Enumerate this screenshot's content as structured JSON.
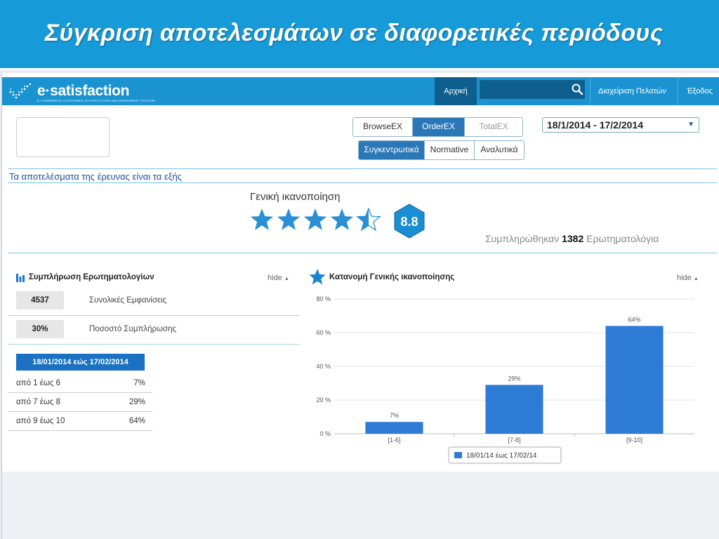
{
  "slide": {
    "title": "Σύγκριση αποτελεσμάτων σε διαφορετικές περιόδους"
  },
  "brand": {
    "name": "e·satisfaction",
    "tagline": "E-COMMERCE CUSTOMER SATISFACTION MEASUREMENT SYSTEM"
  },
  "nav": {
    "home": "Αρχική",
    "search_placeholder": "",
    "customers": "Διαχείριση Πελατών",
    "logout": "Έξοδος"
  },
  "survey_tabs": {
    "items": [
      "BrowseEX",
      "OrderEX",
      "TotalEX"
    ],
    "active": "OrderEX",
    "disabled": "TotalEX"
  },
  "view_tabs": {
    "items": [
      "Συγκεντρωτικά",
      "Normative",
      "Αναλυτικά"
    ],
    "active": "Συγκεντρωτικά"
  },
  "date_range": {
    "selected": "18/1/2014 - 17/2/2014",
    "caret": "▼"
  },
  "results_intro": "Τα αποτελέσματα της έρευνας είναι τα εξής",
  "overall": {
    "title": "Γενική ικανοποίηση",
    "star_rating": 4.5,
    "star_max": 5,
    "score": "8.8",
    "completed_prefix": "Συμπληρώθηκαν",
    "completed_count": "1382",
    "completed_suffix": "Ερωτηματολόγια"
  },
  "completion_panel": {
    "title": "Συμπλήρωση Ερωτηματολογίων",
    "hide": "hide",
    "stats": [
      {
        "value": "4537",
        "label": "Συνολικές Εμφανίσεις"
      },
      {
        "value": "30%",
        "label": "Ποσοστό Συμπλήρωσης"
      }
    ],
    "period_label": "18/01/2014 εώς 17/02/2014",
    "ranges": [
      {
        "label": "από 1 έως 6",
        "value": "7%"
      },
      {
        "label": "από 7 έως 8",
        "value": "29%"
      },
      {
        "label": "από 9 έως 10",
        "value": "64%"
      }
    ]
  },
  "distribution_panel": {
    "title": "Κατανομή Γενικής ικανοποίησης",
    "hide": "hide"
  },
  "chart_data": {
    "type": "bar",
    "categories": [
      "[1-6]",
      "[7-8]",
      "[9-10]"
    ],
    "series": [
      {
        "name": "18/01/14 έως 17/02/14",
        "values": [
          7,
          29,
          64
        ],
        "data_labels": [
          "7%",
          "29%",
          "64%"
        ]
      }
    ],
    "ylim": [
      0,
      80
    ],
    "yticks": [
      0,
      20,
      40,
      60,
      80
    ],
    "ytick_labels": [
      "0 %",
      "20 %",
      "40 %",
      "60 %",
      "80 %"
    ],
    "grid": true,
    "legend": "bottom-center",
    "colors": {
      "bar": "#2e7bd6"
    }
  },
  "colors": {
    "header": "#169bd8",
    "navbar": "#1c93d1",
    "nav_active": "#0f5f8e",
    "accent": "#2b78b8",
    "star": "#2a8fd4"
  }
}
